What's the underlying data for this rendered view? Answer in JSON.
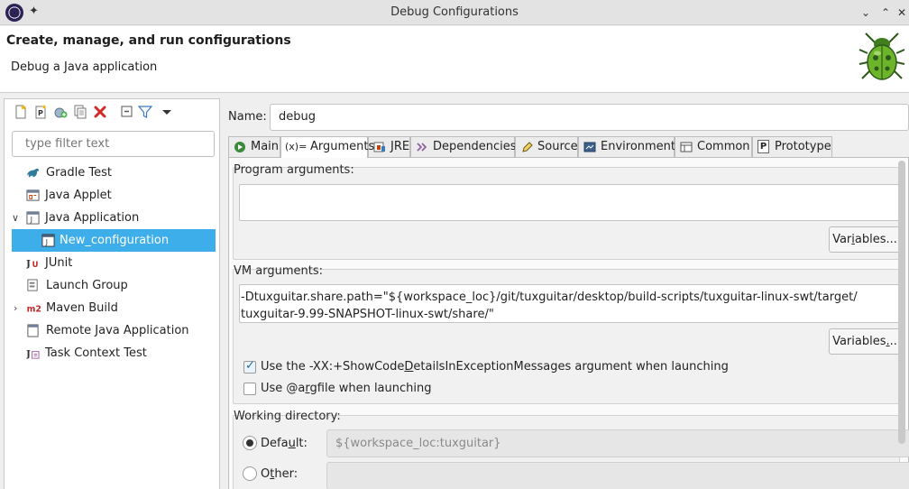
{
  "window": {
    "title": "Debug Configurations",
    "pin_glyph": "✦",
    "minimize_glyph": "⌄",
    "maximize_glyph": "⌃",
    "close_glyph": "✕"
  },
  "header": {
    "title": "Create, manage, and run configurations",
    "subtitle": "Debug a Java application"
  },
  "left": {
    "toolbar": [
      {
        "name": "new-config-icon"
      },
      {
        "name": "new-prototype-icon"
      },
      {
        "name": "export-icon"
      },
      {
        "name": "duplicate-icon"
      },
      {
        "name": "delete-icon"
      },
      {
        "name": "collapse-all-icon"
      },
      {
        "name": "filter-icon"
      },
      {
        "name": "view-menu-icon"
      }
    ],
    "filter_placeholder": "type filter text",
    "tree": [
      {
        "label": "Gradle Test",
        "icon": "gradle-icon",
        "expand": "",
        "level": 0
      },
      {
        "label": "Java Applet",
        "icon": "java-applet-icon",
        "expand": "",
        "level": 0
      },
      {
        "label": "Java Application",
        "icon": "java-application-icon",
        "expand": "∨",
        "level": 0
      },
      {
        "label": "New_configuration",
        "icon": "java-application-icon",
        "expand": "",
        "level": 1,
        "selected": true
      },
      {
        "label": "JUnit",
        "icon": "junit-icon",
        "expand": "",
        "level": 0
      },
      {
        "label": "Launch Group",
        "icon": "launch-group-icon",
        "expand": "",
        "level": 0
      },
      {
        "label": "Maven Build",
        "icon": "maven-icon",
        "expand": "›",
        "level": 0
      },
      {
        "label": "Remote Java Application",
        "icon": "remote-java-icon",
        "expand": "",
        "level": 0
      },
      {
        "label": "Task Context Test",
        "icon": "task-context-icon",
        "expand": "",
        "level": 0
      }
    ]
  },
  "right": {
    "name_label": "Name:",
    "name_value": "debug",
    "tabs": [
      {
        "label": "Main",
        "icon": "main-tab-icon",
        "active": false
      },
      {
        "label": "Arguments",
        "icon": "arguments-tab-icon",
        "glyph": "(x)=",
        "active": true
      },
      {
        "label": "JRE",
        "icon": "jre-tab-icon",
        "active": false
      },
      {
        "label": "Dependencies",
        "icon": "dependencies-tab-icon",
        "active": false
      },
      {
        "label": "Source",
        "icon": "source-tab-icon",
        "active": false
      },
      {
        "label": "Environment",
        "icon": "environment-tab-icon",
        "active": false
      },
      {
        "label": "Common",
        "icon": "common-tab-icon",
        "active": false
      },
      {
        "label": "Prototype",
        "icon": "prototype-tab-icon",
        "glyph": "P",
        "active": false
      }
    ],
    "program_args": {
      "label": "Program arguments:",
      "value": "",
      "variables_prefix": "Var",
      "variables_mnemonic": "i",
      "variables_suffix": "ables..."
    },
    "vm_args": {
      "label": "VM arguments:",
      "line1": "-Dtuxguitar.share.path=\"${workspace_loc}/git/tuxguitar/desktop/build-scripts/tuxguitar-linux-swt/target/",
      "line2": "tuxguitar-9.99-SNAPSHOT-linux-swt/share/\"",
      "variables_prefix": "Variables",
      "variables_mnemonic": ".",
      "variables_suffix": ".."
    },
    "show_code_details": {
      "checked": true,
      "prefix": "Use the -XX:+ShowCode",
      "mnemonic": "D",
      "suffix": "etailsInExceptionMessages argument when launching"
    },
    "argfile": {
      "checked": false,
      "prefix": "Use @a",
      "mnemonic": "r",
      "suffix": "gfile when launching"
    },
    "working_dir": {
      "label": "Working directory:",
      "default_prefix": "Defa",
      "default_mnemonic": "u",
      "default_suffix": "lt:",
      "default_value": "${workspace_loc:tuxguitar}",
      "other_prefix": "O",
      "other_mnemonic": "t",
      "other_suffix": "her:",
      "other_value": "",
      "selected": "default"
    }
  },
  "colors": {
    "selection": "#3daee9",
    "checkbox_check": "#2b6aa1",
    "delete_icon": "#d42a2a"
  }
}
